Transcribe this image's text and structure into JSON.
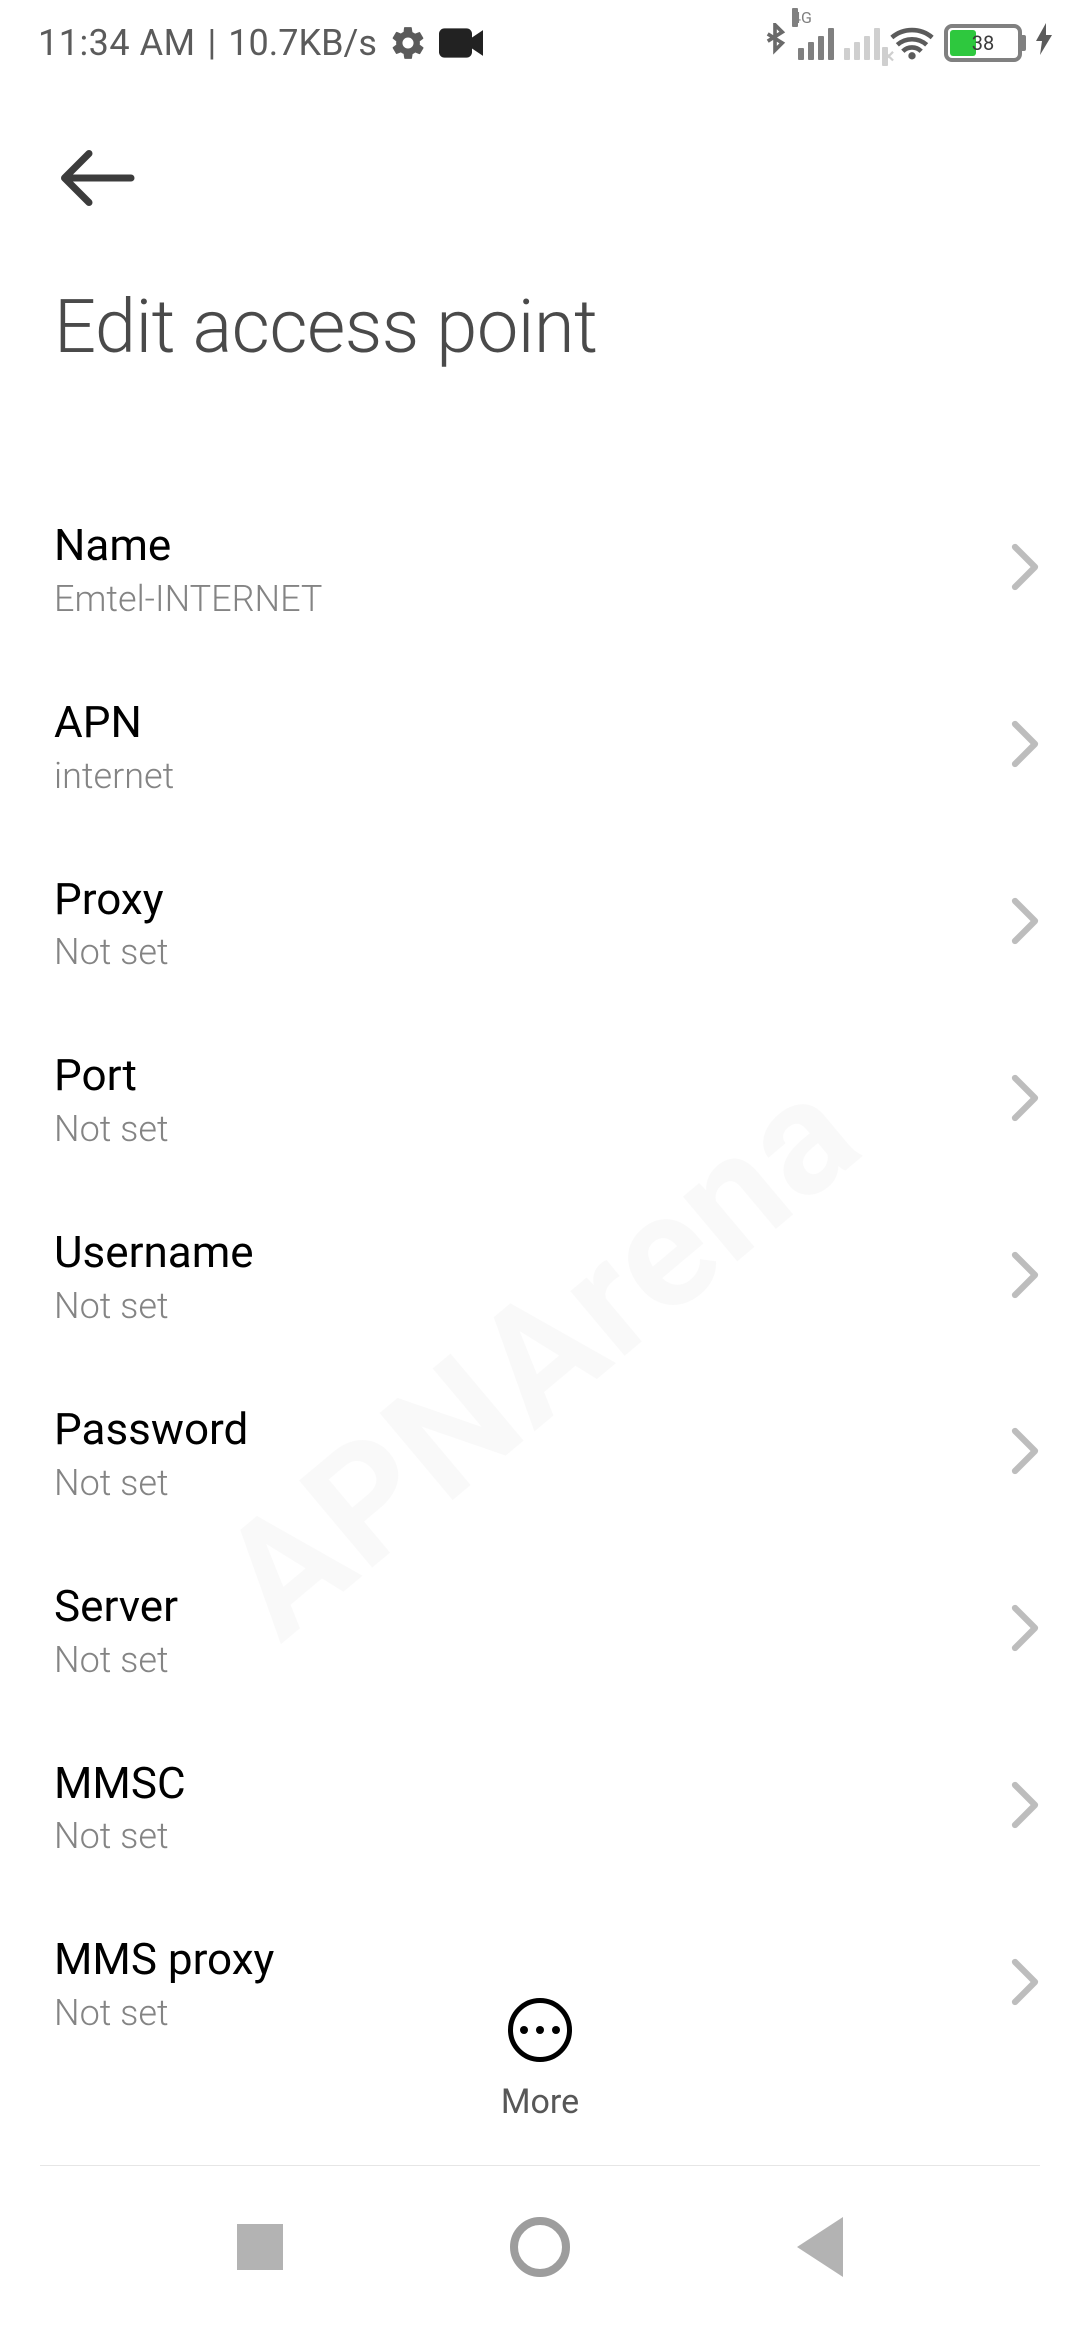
{
  "status": {
    "time": "11:34 AM",
    "separator": " | ",
    "speed": "10.7KB/s",
    "network_label": "4G",
    "battery_pct": "38",
    "bolt": "⚡"
  },
  "header": {
    "title": "Edit access point"
  },
  "settings_list": [
    {
      "label": "Name",
      "value": "Emtel-INTERNET"
    },
    {
      "label": "APN",
      "value": "internet"
    },
    {
      "label": "Proxy",
      "value": "Not set"
    },
    {
      "label": "Port",
      "value": "Not set"
    },
    {
      "label": "Username",
      "value": "Not set"
    },
    {
      "label": "Password",
      "value": "Not set"
    },
    {
      "label": "Server",
      "value": "Not set"
    },
    {
      "label": "MMSC",
      "value": "Not set"
    },
    {
      "label": "MMS proxy",
      "value": "Not set"
    }
  ],
  "toolbar": {
    "more_label": "More"
  },
  "watermark": "APNArena"
}
